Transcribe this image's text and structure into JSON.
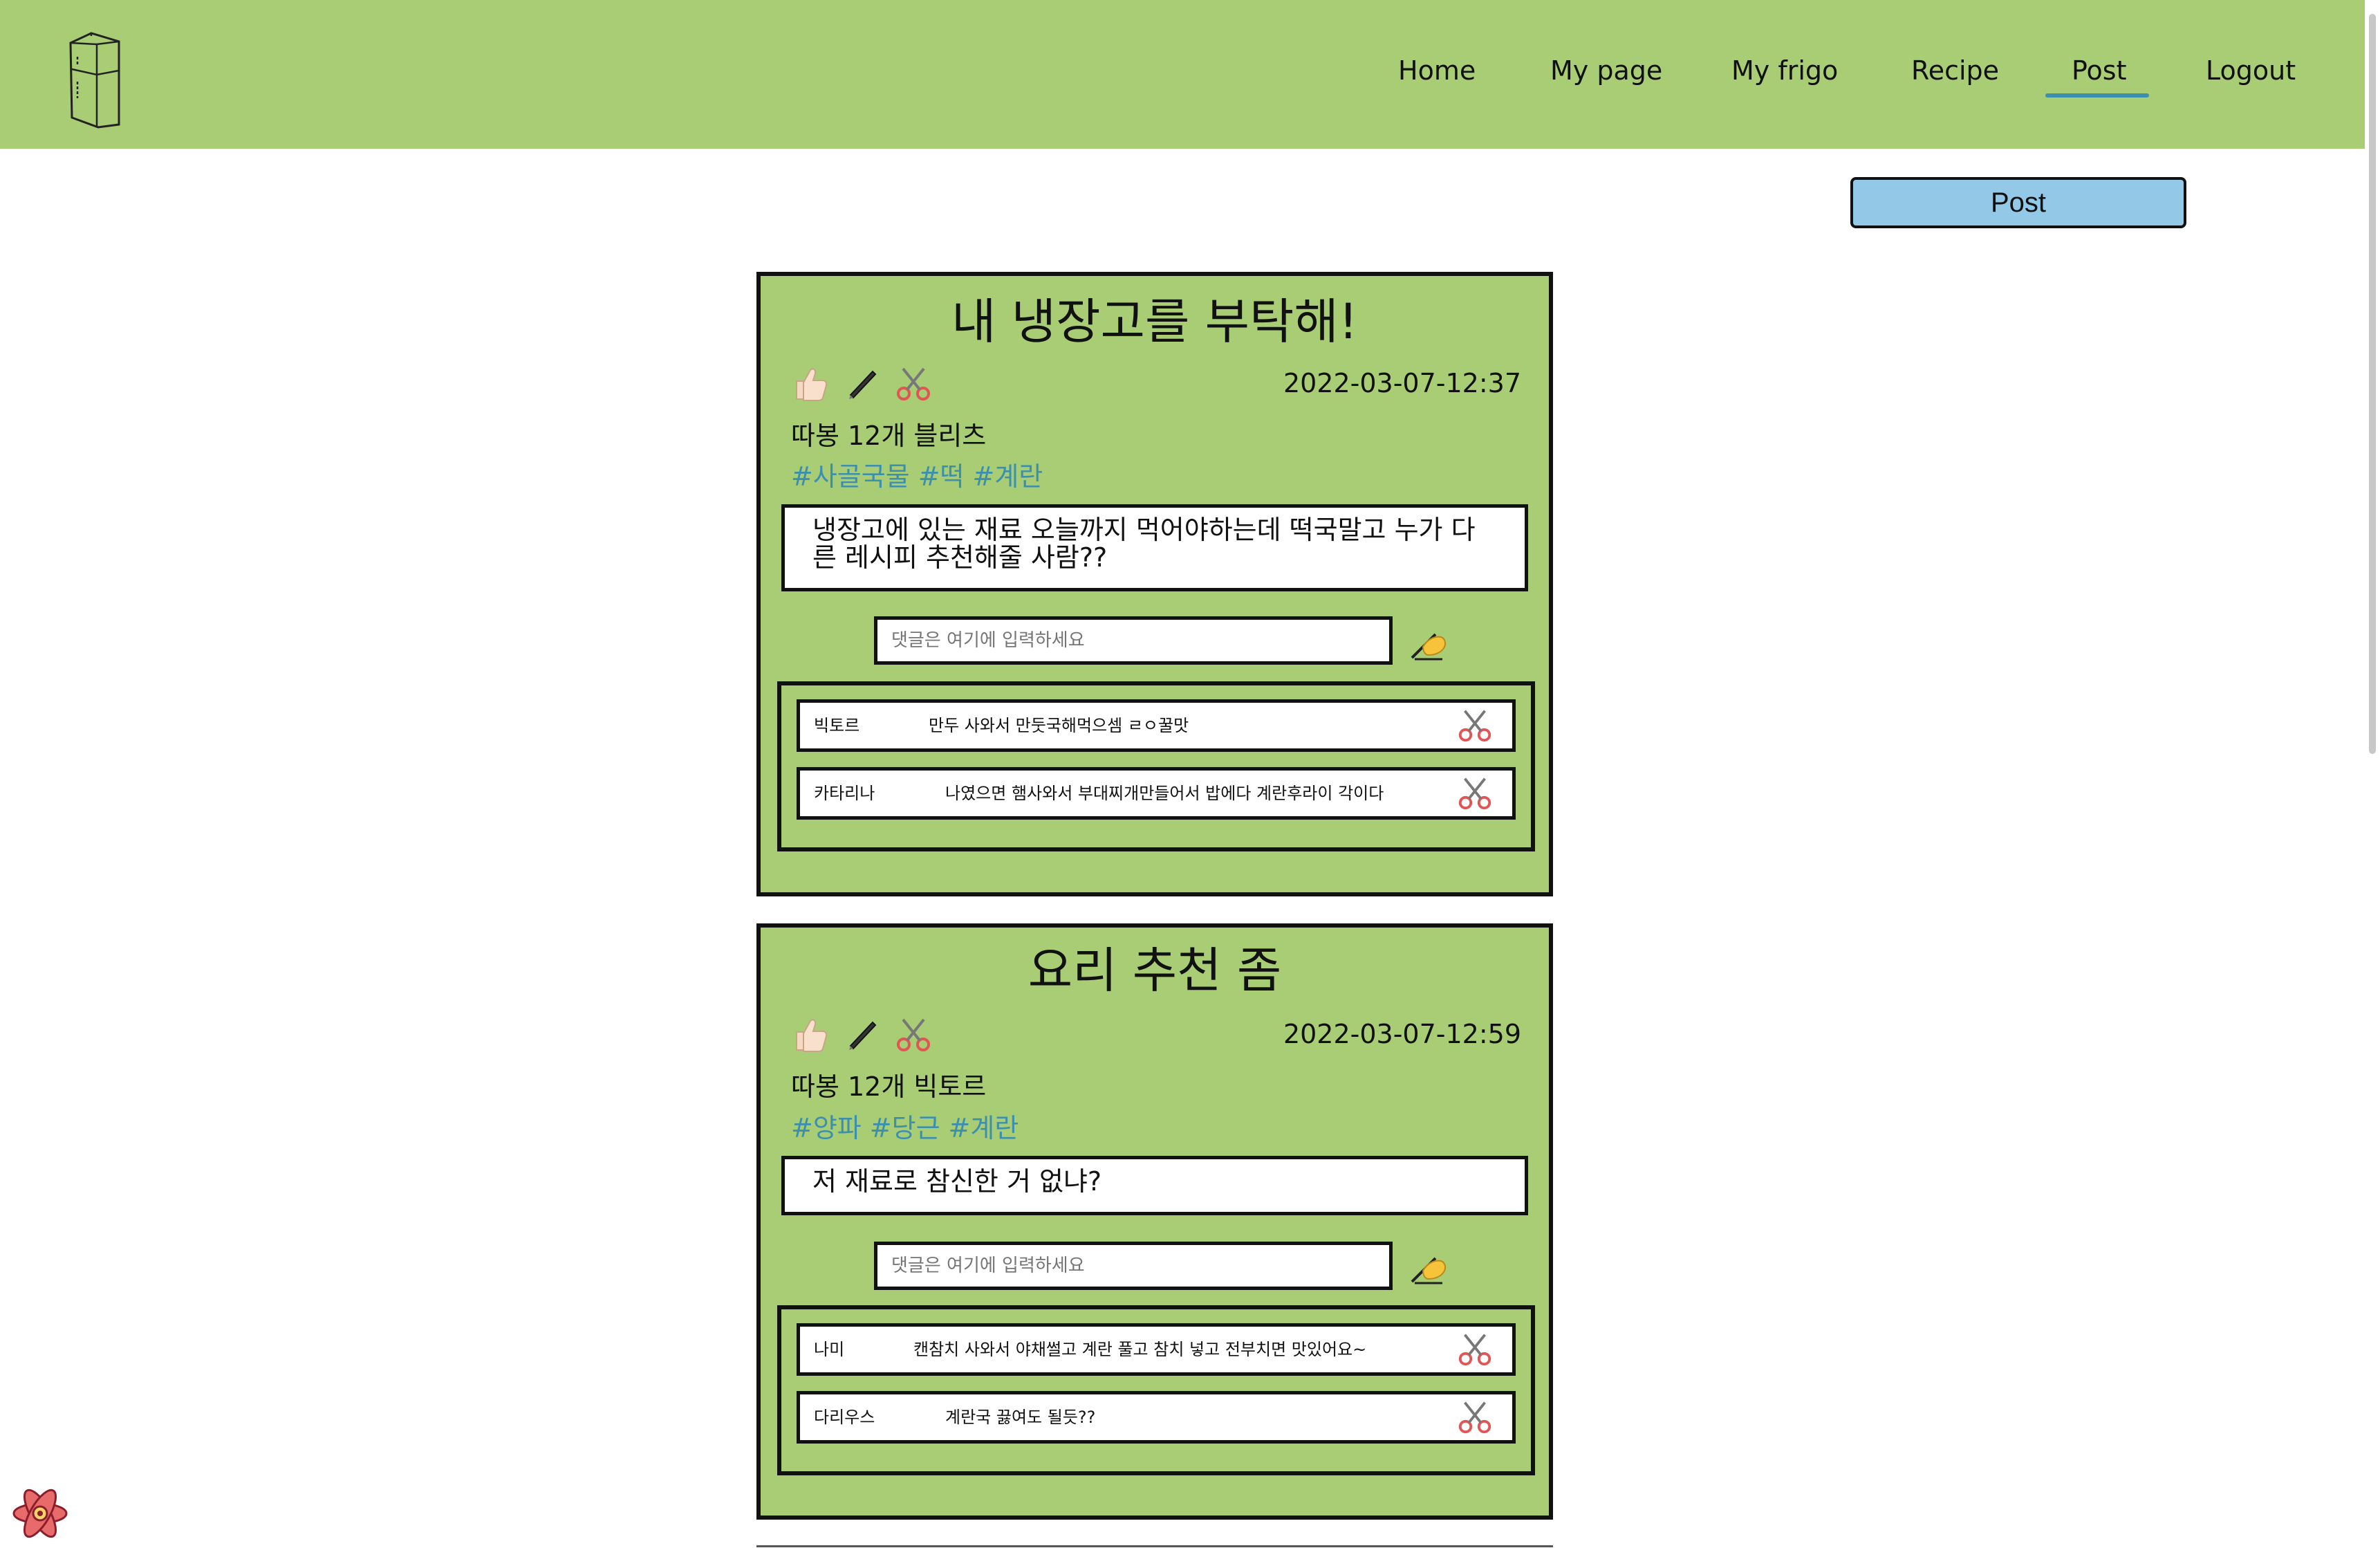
{
  "nav": {
    "items": [
      "Home",
      "My page",
      "My frigo",
      "Recipe",
      "Post",
      "Logout"
    ],
    "active": "Post"
  },
  "post_button_label": "Post",
  "comment_placeholder": "댓글은 여기에 입력하세요",
  "colors": {
    "header": "#a8cd75",
    "card": "#a8cd75",
    "tag": "#3d8fae",
    "post_button": "#93c8e6"
  },
  "posts": [
    {
      "title": "내 냉장고를 부탁해!",
      "date": "2022-03-07-12:37",
      "author_line": "따봉 12개  블리츠",
      "tags": [
        "#사골국물",
        "#떡",
        "#계란"
      ],
      "body": "냉장고에 있는 재료 오늘까지 먹어야하는데 떡국말고 누가 다른 레시피 추천해줄 사람??",
      "comments": [
        {
          "author": "빅토르",
          "text": "만두 사와서 만둣국해먹으셈 ㄹㅇ꿀맛"
        },
        {
          "author": "카타리나",
          "text": "나였으면 햄사와서 부대찌개만들어서 밥에다 계란후라이 각이다"
        }
      ]
    },
    {
      "title": "요리 추천 좀",
      "date": "2022-03-07-12:59",
      "author_line": "따봉 12개  빅토르",
      "tags": [
        "#양파",
        "#당근",
        "#계란"
      ],
      "body": "저 재료로 참신한 거 없냐?",
      "comments": [
        {
          "author": "나미",
          "text": "캔참치 사와서 야채썰고 계란 풀고 참치 넣고 전부치면 맛있어요~"
        },
        {
          "author": "다리우스",
          "text": "계란국 끓여도 될듯??"
        }
      ]
    }
  ]
}
